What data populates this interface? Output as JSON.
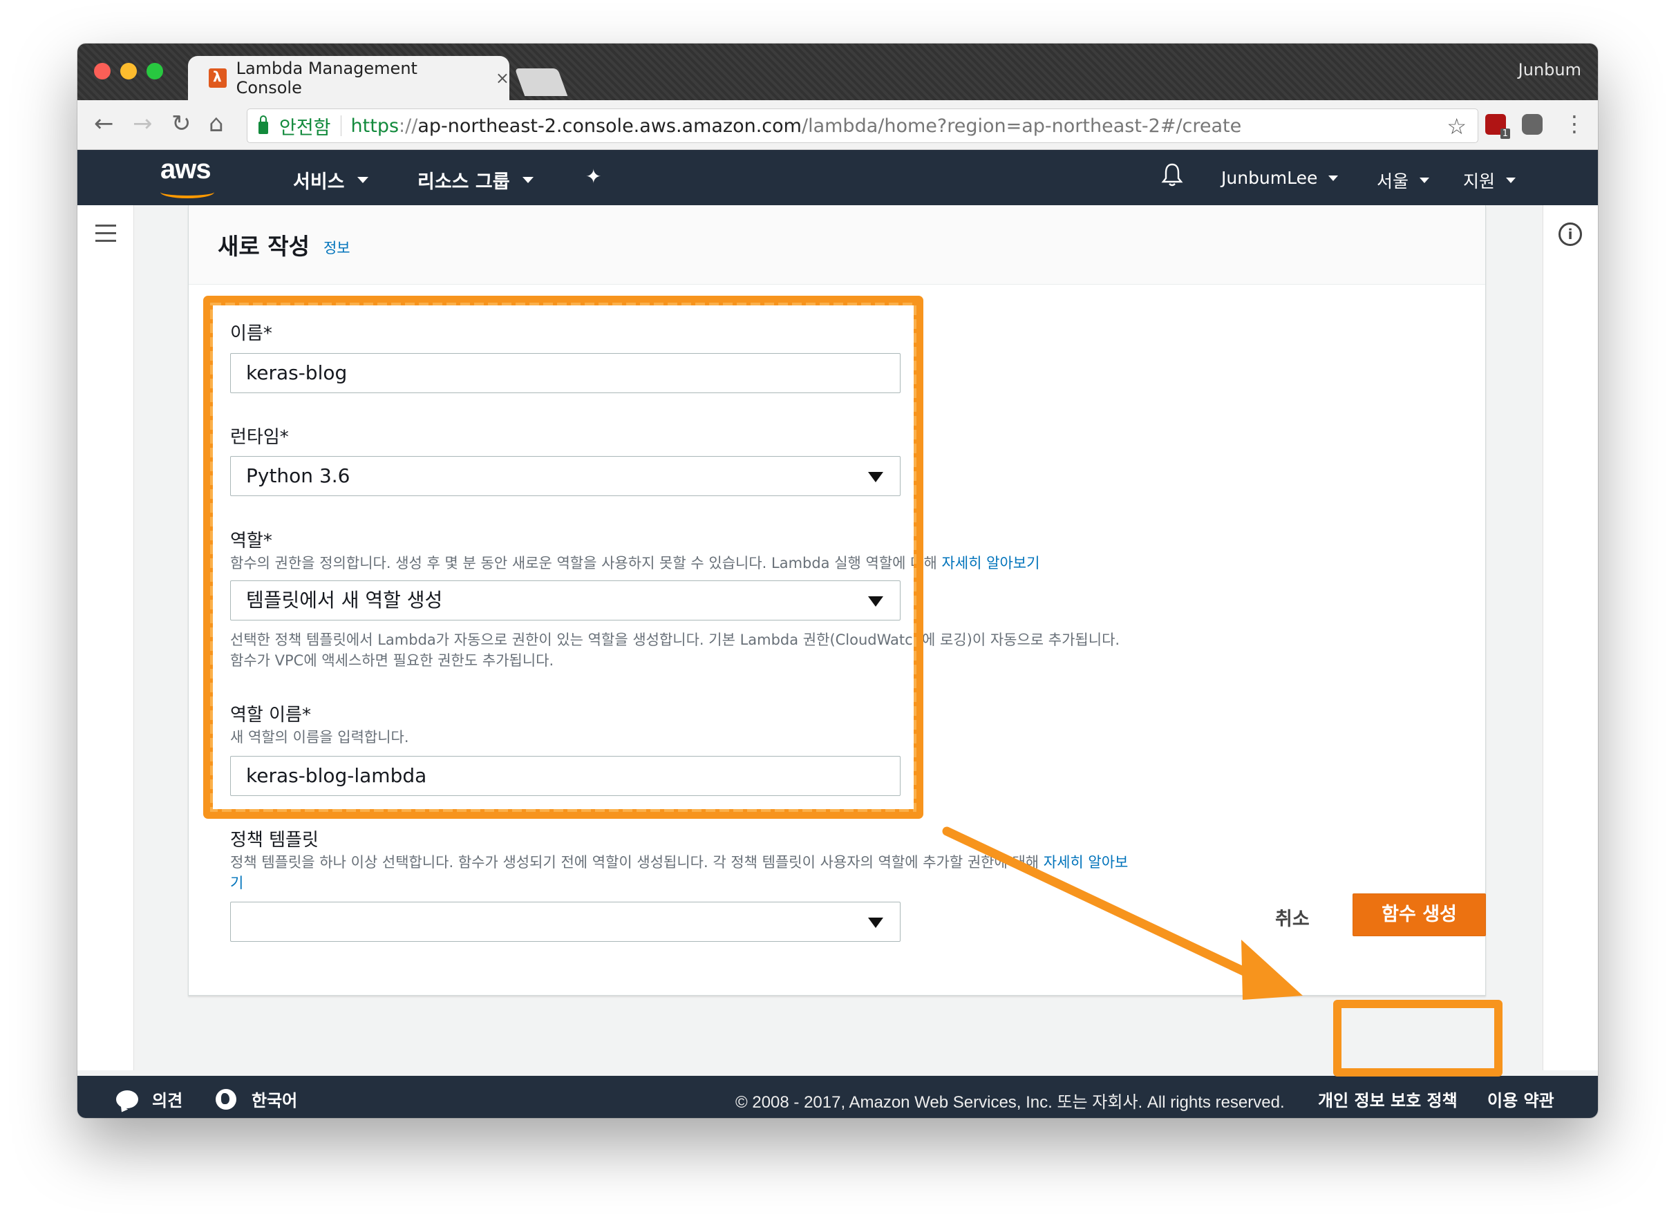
{
  "browser": {
    "tab_title": "Lambda Management Console",
    "tab_close": "×",
    "profile_name": "Junbum",
    "secure_label": "안전함",
    "url_scheme": "https",
    "url_sep": "://",
    "url_host": "ap-northeast-2.console.aws.amazon.com",
    "url_path": "/lambda/home?region=ap-northeast-2#/create",
    "ext_badge": "1"
  },
  "aws_header": {
    "logo": "aws",
    "services": "서비스",
    "resource_groups": "리소스 그룹",
    "username": "JunbumLee",
    "region": "서울",
    "support": "지원"
  },
  "panel": {
    "title": "새로 작성",
    "info_link": "정보"
  },
  "form": {
    "name_label": "이름*",
    "name_value": "keras-blog",
    "runtime_label": "런타임*",
    "runtime_value": "Python 3.6",
    "role_label": "역할*",
    "role_help": "함수의 권한을 정의합니다. 생성 후 몇 분 동안 새로운 역할을 사용하지 못할 수 있습니다. Lambda 실행 역할에 대해 ",
    "role_help_link": "자세히 알아보기",
    "role_value": "템플릿에서 새 역할 생성",
    "role_desc": "선택한 정책 템플릿에서 Lambda가 자동으로 권한이 있는 역할을 생성합니다. 기본 Lambda 권한(CloudWatch에 로깅)이 자동으로 추가됩니다. 함수가 VPC에 액세스하면 필요한 권한도 추가됩니다.",
    "role_name_label": "역할 이름*",
    "role_name_help": "새 역할의 이름을 입력합니다.",
    "role_name_value": "keras-blog-lambda",
    "policy_label": "정책 템플릿",
    "policy_help": "정책 템플릿을 하나 이상 선택합니다. 함수가 생성되기 전에 역할이 생성됩니다. 각 정책 템플릿이 사용자의 역할에 추가할 권한에 대해 ",
    "policy_help_link": "자세히 알아보기",
    "policy_value": ""
  },
  "actions": {
    "cancel": "취소",
    "create": "함수 생성"
  },
  "footer": {
    "feedback": "의견",
    "language": "한국어",
    "copyright": "© 2008 - 2017, Amazon Web Services, Inc. 또는 자회사. All rights reserved.",
    "privacy": "개인 정보 보호 정책",
    "terms": "이용 약관"
  },
  "colors": {
    "aws_nav": "#232f3e",
    "primary_button": "#ec7211",
    "link": "#0073bb",
    "annotation": "#f7941d"
  }
}
